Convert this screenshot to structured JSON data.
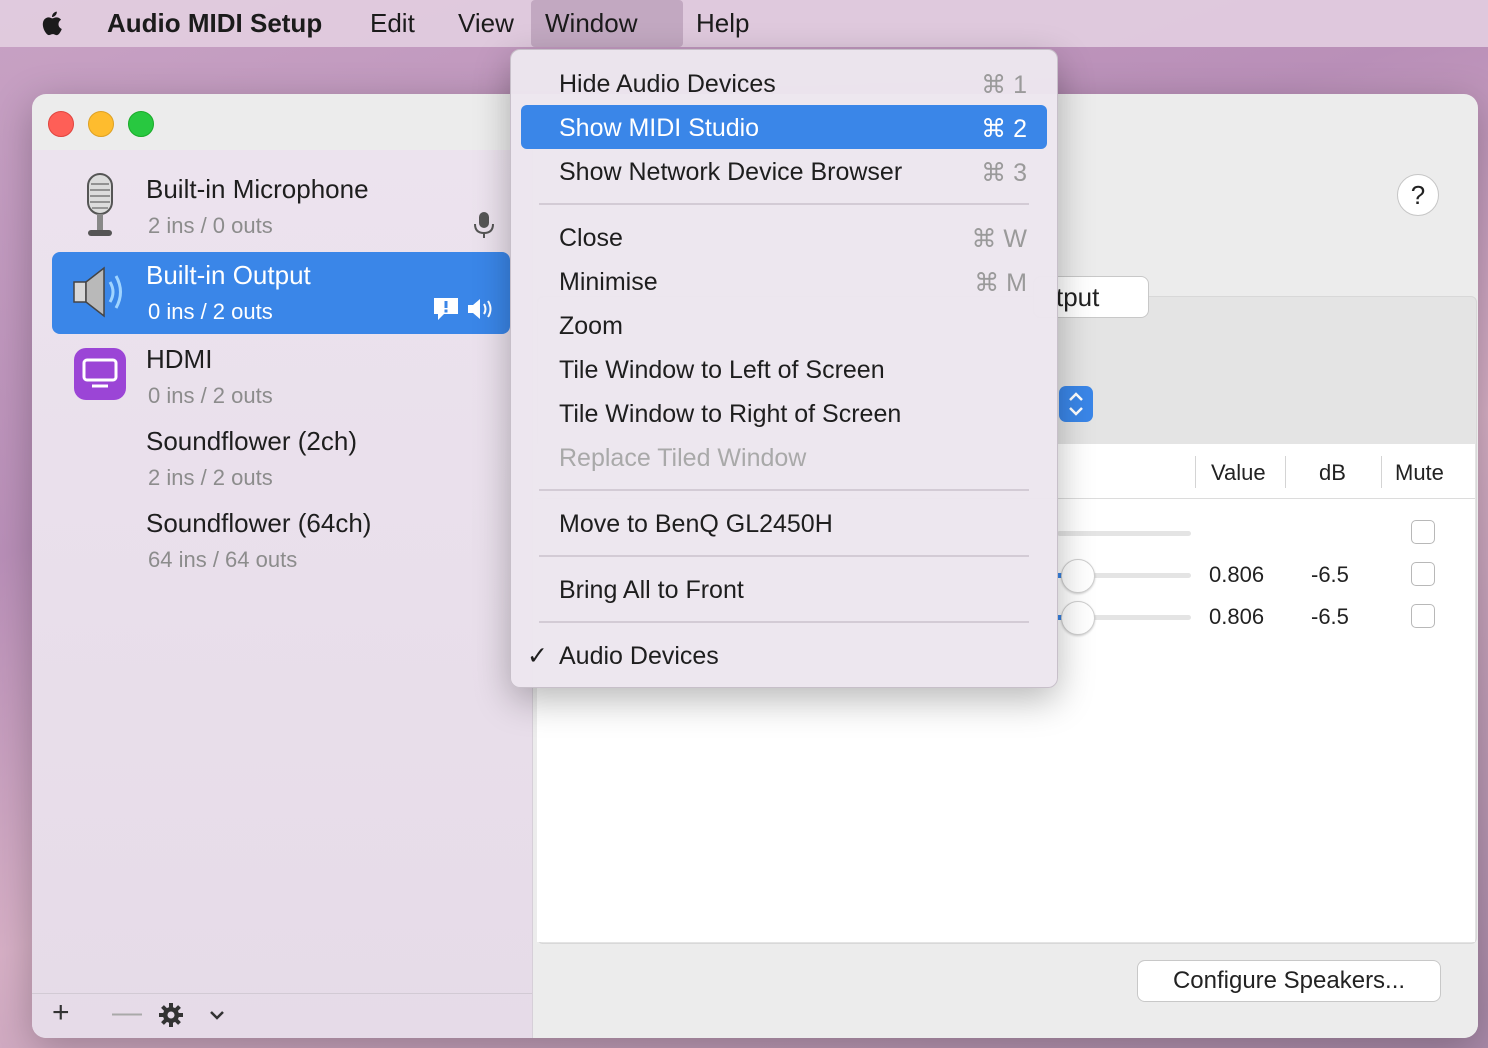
{
  "menubar": {
    "app_name": "Audio MIDI Setup",
    "items": [
      "Edit",
      "View",
      "Window",
      "Help"
    ]
  },
  "window_menu": {
    "items": [
      {
        "label": "Hide Audio Devices",
        "shortcut": "⌘ 1"
      },
      {
        "label": "Show MIDI Studio",
        "shortcut": "⌘ 2"
      },
      {
        "label": "Show Network Device Browser",
        "shortcut": "⌘ 3"
      },
      {
        "label": "Close",
        "shortcut": "⌘ W"
      },
      {
        "label": "Minimise",
        "shortcut": "⌘ M"
      },
      {
        "label": "Zoom",
        "shortcut": ""
      },
      {
        "label": "Tile Window to Left of Screen",
        "shortcut": ""
      },
      {
        "label": "Tile Window to Right of Screen",
        "shortcut": ""
      },
      {
        "label": "Replace Tiled Window",
        "shortcut": ""
      },
      {
        "label": "Move to BenQ GL2450H",
        "shortcut": ""
      },
      {
        "label": "Bring All to Front",
        "shortcut": ""
      },
      {
        "label": "Audio Devices",
        "shortcut": "",
        "check": "✓"
      }
    ]
  },
  "devices": [
    {
      "name": "Built-in Microphone",
      "io": "2 ins / 0 outs"
    },
    {
      "name": "Built-in Output",
      "io": "0 ins / 2 outs"
    },
    {
      "name": "HDMI",
      "io": "0 ins / 2 outs"
    },
    {
      "name": "Soundflower (2ch)",
      "io": "2 ins / 2 outs"
    },
    {
      "name": "Soundflower (64ch)",
      "io": "64 ins / 64 outs"
    }
  ],
  "sidebar_toolbar": {
    "add": "+",
    "remove": "—"
  },
  "main": {
    "help": "?",
    "tab_partial": "tput",
    "columns": {
      "value": "Value",
      "db": "dB",
      "mute": "Mute"
    },
    "rows": [
      {
        "value": "",
        "db": ""
      },
      {
        "value": "0.806",
        "db": "-6.5"
      },
      {
        "value": "0.806",
        "db": "-6.5"
      }
    ],
    "configure_button": "Configure Speakers..."
  },
  "colors": {
    "accent": "#3a86e8",
    "highlight": "#3a86e8"
  }
}
